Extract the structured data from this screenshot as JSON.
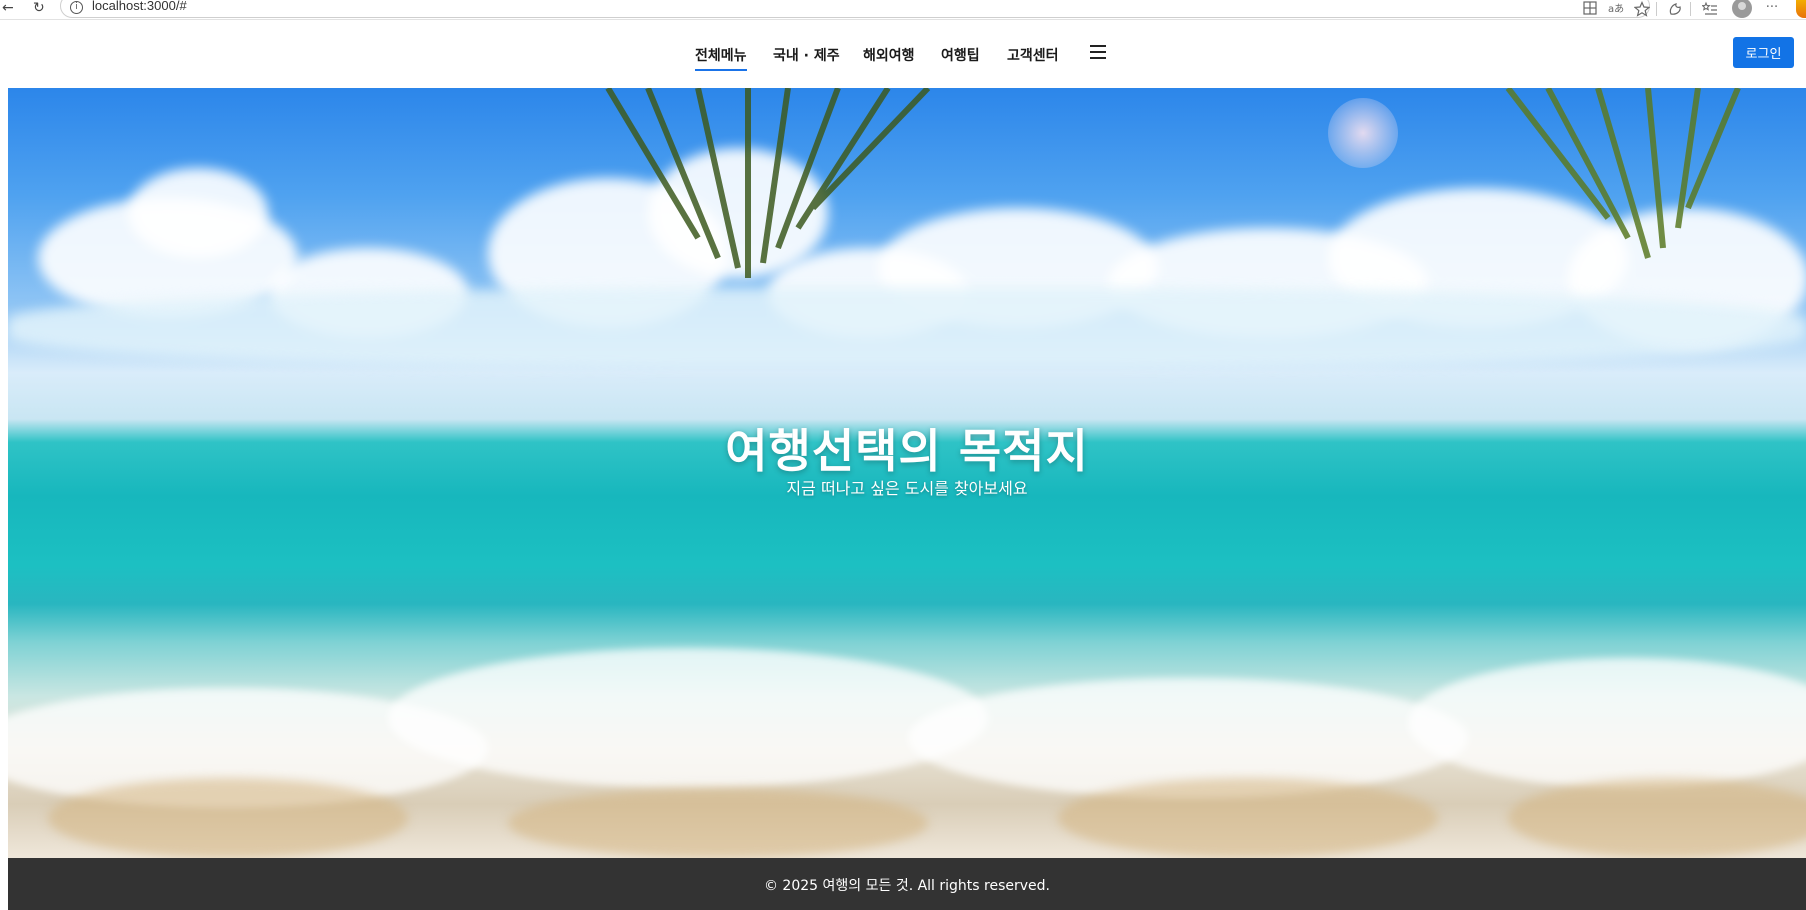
{
  "browser": {
    "back_glyph": "←",
    "reload_glyph": "↻",
    "info_glyph": "i",
    "url": "localhost:3000/#",
    "more_glyph": "···"
  },
  "header": {
    "nav_items": [
      {
        "label": "전체메뉴",
        "active": true
      },
      {
        "label": "국내 · 제주",
        "active": false
      },
      {
        "label": "해외여행",
        "active": false
      },
      {
        "label": "여행팁",
        "active": false
      },
      {
        "label": "고객센터",
        "active": false
      }
    ],
    "login_label": "로그인"
  },
  "hero": {
    "title": "여행선택의 목적지",
    "subtitle": "지금 떠나고 싶은 도시를 찾아보세요"
  },
  "footer": {
    "copyright": "© 2025 여행의 모든 것. All rights reserved."
  },
  "colors": {
    "accent": "#1273e6",
    "active_underline": "#1a73e8",
    "footer_bg": "#333333"
  }
}
